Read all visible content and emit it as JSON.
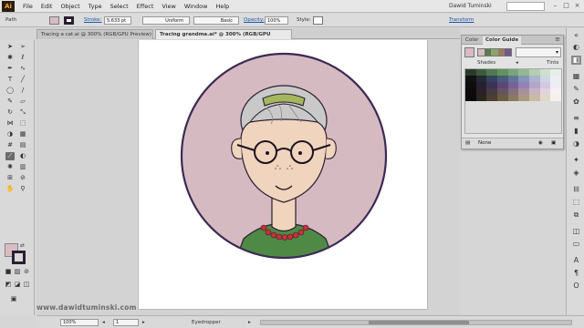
{
  "app": {
    "logo": "Ai",
    "user": "Dawid Tuminski",
    "menus": [
      "File",
      "Edit",
      "Object",
      "Type",
      "Select",
      "Effect",
      "View",
      "Window",
      "Help"
    ]
  },
  "control_bar": {
    "selection_label": "Path",
    "stroke_label": "Stroke:",
    "stroke_weight": "5.633 pt",
    "profile": "Uniform",
    "brush": "Basic",
    "opacity_label": "Opacity:",
    "opacity_value": "100%",
    "style_label": "Style:",
    "transform_label": "Transform"
  },
  "tabs": [
    {
      "label": "Tracing a cat.ai @ 300% (RGB/GPU Preview)"
    },
    {
      "label": "Tracing grandma.ai* @ 300% (RGB/GPU Preview)"
    }
  ],
  "color_panel": {
    "tab_color": "Color",
    "tab_guide": "Color Guide",
    "shades": "Shades",
    "tints": "Tints",
    "footer": "None",
    "base_color": "#d8bcc3"
  },
  "status_bar": {
    "zoom": "100%",
    "page": "1",
    "tool": "Eyedropper"
  },
  "watermark": "www.dawidtuminski.com",
  "colors": {
    "background_circle": "#d5bbc1",
    "circle_stroke": "#3b2a55",
    "skin": "#f0d4bd",
    "hair": "#c9c9c9",
    "hair_band": "#a3b85e",
    "shirt": "#4e8a45",
    "necklace": "#c0343f"
  }
}
